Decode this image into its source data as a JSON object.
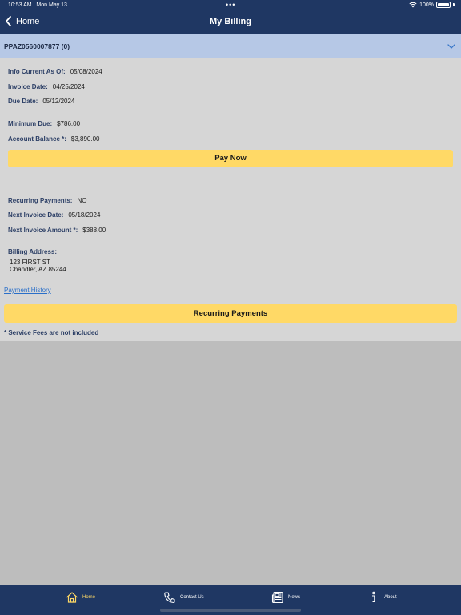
{
  "status": {
    "time": "10:53 AM",
    "date": "Mon May 13",
    "dots": "•••",
    "battery": "100%"
  },
  "nav": {
    "back_label": "Home",
    "title": "My Billing"
  },
  "account": {
    "label": "PPAZ0560007877 (0)"
  },
  "info": {
    "info_current_label": "Info Current As Of:",
    "info_current": "05/08/2024",
    "invoice_date_label": "Invoice Date:",
    "invoice_date": "04/25/2024",
    "due_date_label": "Due Date:",
    "due_date": "05/12/2024",
    "minimum_due_label": "Minimum Due:",
    "minimum_due": "$786.00",
    "account_balance_label": "Account Balance *:",
    "account_balance": "$3,890.00"
  },
  "pay_now_label": "Pay Now",
  "recurring": {
    "recurring_payments_label": "Recurring Payments:",
    "recurring_payments": "NO",
    "next_invoice_date_label": "Next Invoice Date:",
    "next_invoice_date": "05/18/2024",
    "next_invoice_amount_label": "Next Invoice Amount *:",
    "next_invoice_amount": "$388.00"
  },
  "billing_address": {
    "label": "Billing Address:",
    "line1": "123 FIRST ST",
    "line2": "Chandler, AZ 85244"
  },
  "payment_history_label": "Payment History",
  "recurring_payments_button": "Recurring Payments",
  "footnote": "* Service Fees are not included",
  "tabs": [
    {
      "label": "Home",
      "icon": "home-icon",
      "active": true
    },
    {
      "label": "Contact Us",
      "icon": "phone-icon",
      "active": false
    },
    {
      "label": "News",
      "icon": "newspaper-icon",
      "active": false
    },
    {
      "label": "About",
      "icon": "info-icon",
      "active": false
    }
  ],
  "colors": {
    "navy": "#1f3763",
    "header_blue": "#b6c8e6",
    "button_yellow": "#ffd966",
    "content_bg": "#d6d6d6",
    "empty_bg": "#bdbdbd",
    "link": "#2a6fc9"
  }
}
